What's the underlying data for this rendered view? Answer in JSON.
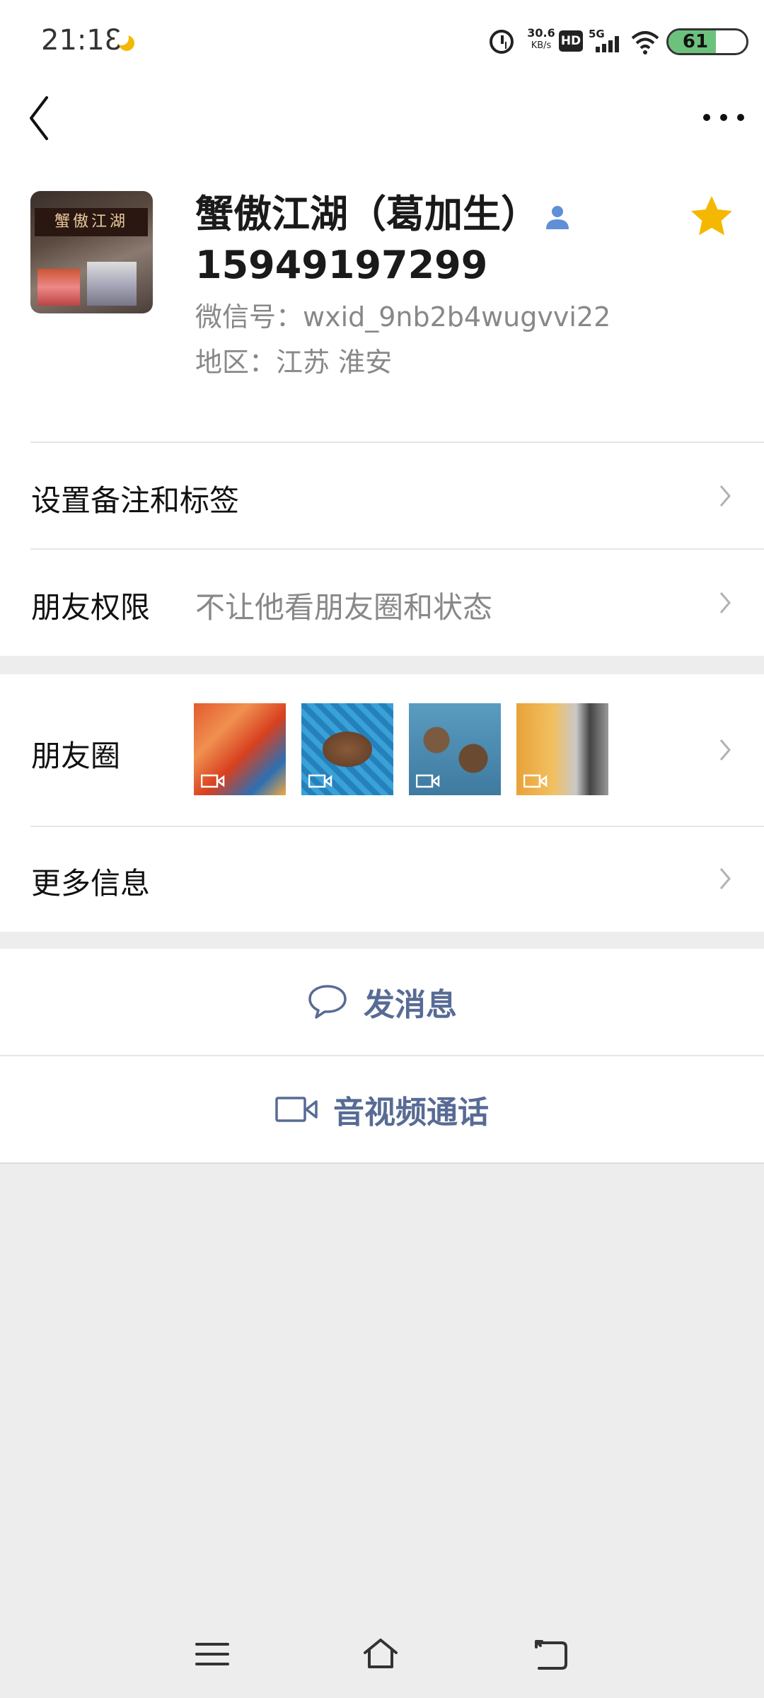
{
  "status_bar": {
    "time": "21:18",
    "net_speed_value": "30.6",
    "net_speed_unit": "KB/s",
    "hd_label": "HD",
    "network_label": "5G",
    "battery_level": 61,
    "battery_text": "61"
  },
  "profile": {
    "name": "蟹傲江湖（葛加生）",
    "phone": "15949197299",
    "wechat_id": "微信号：wxid_9nb2b4wugvvi22",
    "region": "地区：江苏  淮安",
    "avatar_sign_text": "蟹傲江湖",
    "starred": true,
    "star_color": "#f5b800"
  },
  "rows": {
    "remark_tags": "设置备注和标签",
    "friend_permissions_label": "朋友权限",
    "friend_permissions_value": "不让他看朋友圈和状态",
    "moments_label": "朋友圈",
    "more_info": "更多信息"
  },
  "moments_thumbnails": [
    {
      "icon": "video-camera-icon"
    },
    {
      "icon": "video-camera-icon"
    },
    {
      "icon": "video-camera-icon"
    },
    {
      "icon": "video-camera-icon"
    }
  ],
  "actions": {
    "send_message": "发消息",
    "av_call": "音视频通话",
    "accent_color": "#576b95"
  },
  "system_nav": {
    "icons": [
      "menu-icon",
      "home-icon",
      "back-icon"
    ]
  }
}
